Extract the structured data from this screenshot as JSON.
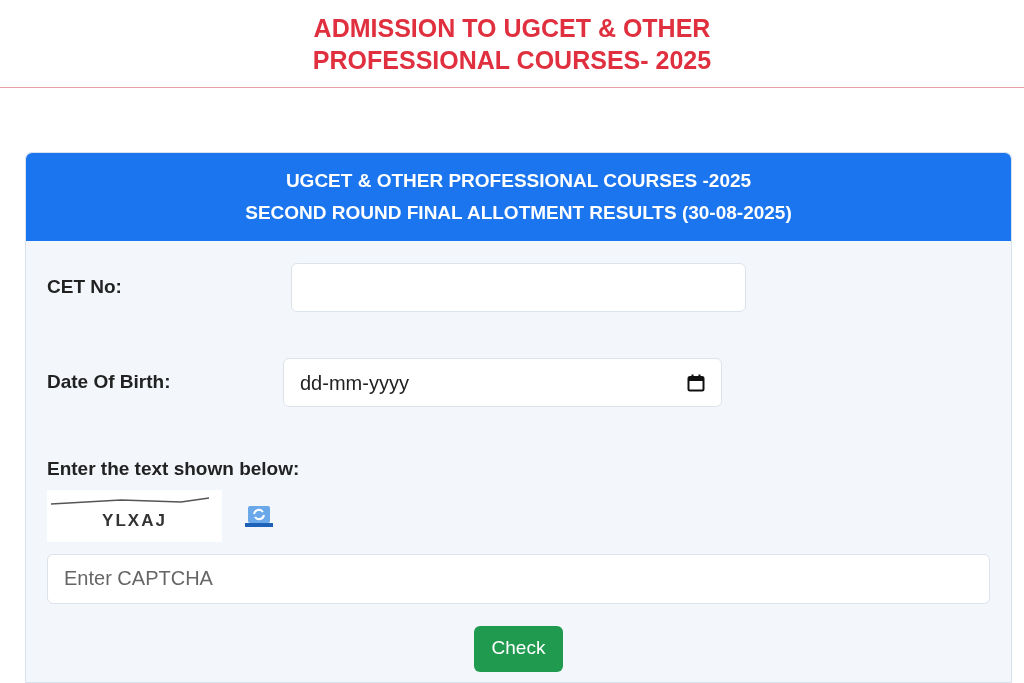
{
  "page_title": [
    "ADMISSION TO UGCET & OTHER",
    "PROFESSIONAL COURSES- 2025"
  ],
  "card": {
    "title_lines": [
      "UGCET & OTHER PROFESSIONAL COURSES -2025",
      "SECOND ROUND FINAL ALLOTMENT RESULTS (30-08-2025)"
    ],
    "fields": [
      {
        "kind": "text",
        "label": "CET No:"
      },
      {
        "kind": "date",
        "label": "Date Of Birth:",
        "placeholder": "dd-mm-yyyy"
      }
    ],
    "captcha": {
      "label": "Enter the text shown below:",
      "code": "YLXAJ",
      "placeholder": "Enter CAPTCHA"
    },
    "button": "Check"
  }
}
